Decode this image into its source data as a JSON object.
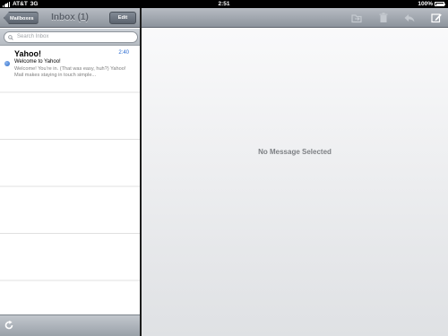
{
  "status_bar": {
    "carrier": "AT&T",
    "network": "3G",
    "time": "2:51",
    "battery": "100%"
  },
  "left_pane": {
    "back_button": "Mailboxes",
    "title": "Inbox (1)",
    "edit_button": "Edit",
    "search_placeholder": "Search Inbox",
    "messages": [
      {
        "from": "Yahoo!",
        "time": "2:40",
        "subject": "Welcome to Yahoo!",
        "preview": "Welcome! You're in. (That was easy, huh?) Yahoo! Mail makes staying in touch simple...",
        "unread": true
      }
    ]
  },
  "right_pane": {
    "empty_message": "No Message Selected",
    "toolbar_icons": [
      "folder-icon",
      "trash-icon",
      "reply-icon",
      "compose-icon"
    ]
  },
  "colors": {
    "accent": "#2a6ad0",
    "toolbar": "#9aa1a9"
  }
}
